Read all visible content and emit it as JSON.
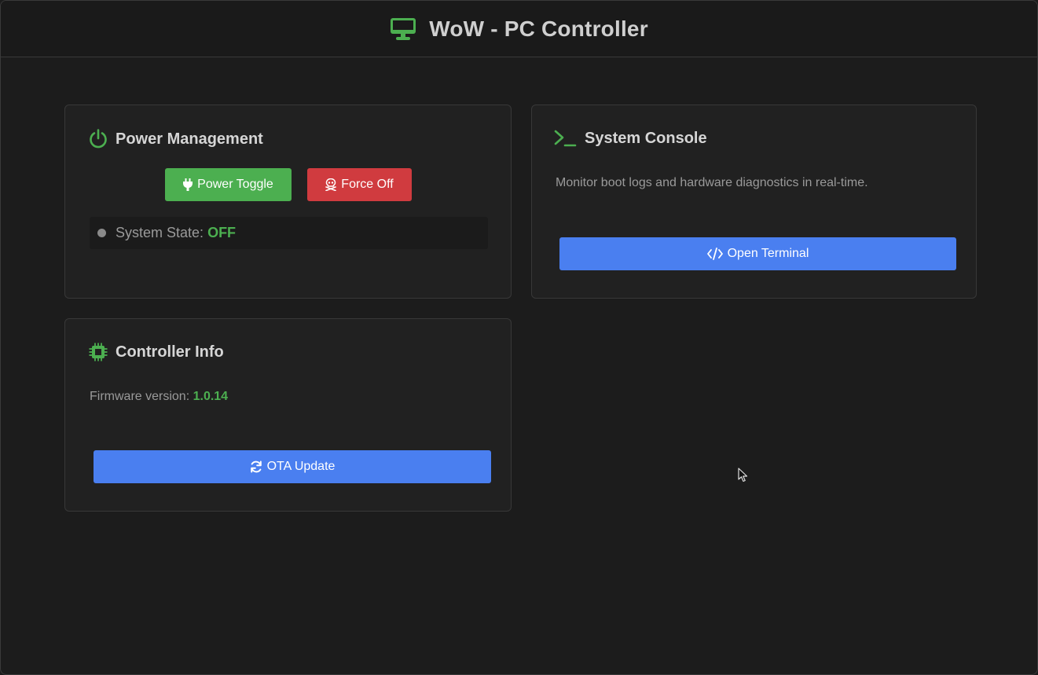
{
  "header": {
    "title": "WoW - PC Controller",
    "icon": "monitor-icon"
  },
  "colors": {
    "accent_green": "#4caf50",
    "danger_red": "#d03b3f",
    "primary_blue": "#4a7ff0",
    "background": "#1c1c1c",
    "card": "#212121"
  },
  "power": {
    "title": "Power Management",
    "icon": "power-icon",
    "toggle_label": "Power Toggle",
    "toggle_icon": "plug-icon",
    "force_off_label": "Force Off",
    "force_off_icon": "skull-crossbones-icon",
    "state_label": "System State:",
    "state_value": "OFF"
  },
  "console": {
    "title": "System Console",
    "icon": "terminal-icon",
    "description": "Monitor boot logs and hardware diagnostics in real-time.",
    "open_label": "Open Terminal",
    "open_icon": "code-icon"
  },
  "controller": {
    "title": "Controller Info",
    "icon": "microchip-icon",
    "firmware_label": "Firmware version:",
    "firmware_value": "1.0.14",
    "ota_label": "OTA Update",
    "ota_icon": "refresh-icon"
  }
}
